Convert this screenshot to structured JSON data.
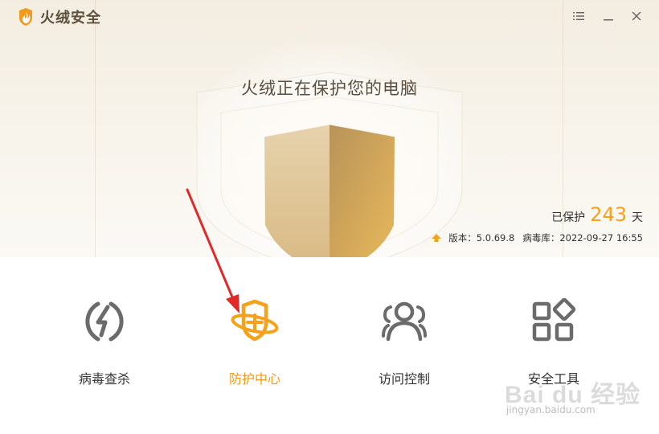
{
  "app": {
    "title": "火绒安全"
  },
  "window_controls": {
    "menu": "menu-icon",
    "minimize": "minimize-icon",
    "close": "close-icon"
  },
  "hero": {
    "status_title": "火绒正在保护您的电脑",
    "protected_prefix": "已保护",
    "protected_days": "243",
    "protected_suffix": "天",
    "version_label": "版本：",
    "version_value": "5.0.69.8",
    "virus_db_label": "病毒库：",
    "virus_db_value": "2022-09-27 16:55"
  },
  "tools": [
    {
      "label": "病毒查杀",
      "icon": "lightning-circle-icon",
      "active": false
    },
    {
      "label": "防护中心",
      "icon": "shield-orbit-icon",
      "active": true
    },
    {
      "label": "访问控制",
      "icon": "users-icon",
      "active": false
    },
    {
      "label": "安全工具",
      "icon": "apps-grid-icon",
      "active": false
    }
  ],
  "watermark": {
    "brand": "Bai du 经验",
    "url": "jingyan.baidu.com"
  },
  "colors": {
    "accent": "#f5a21b",
    "text_dark": "#333333",
    "icon_gray": "#6b6b6b",
    "shield_gold": "#c9a66b",
    "annotation_red": "#e02a2a"
  }
}
